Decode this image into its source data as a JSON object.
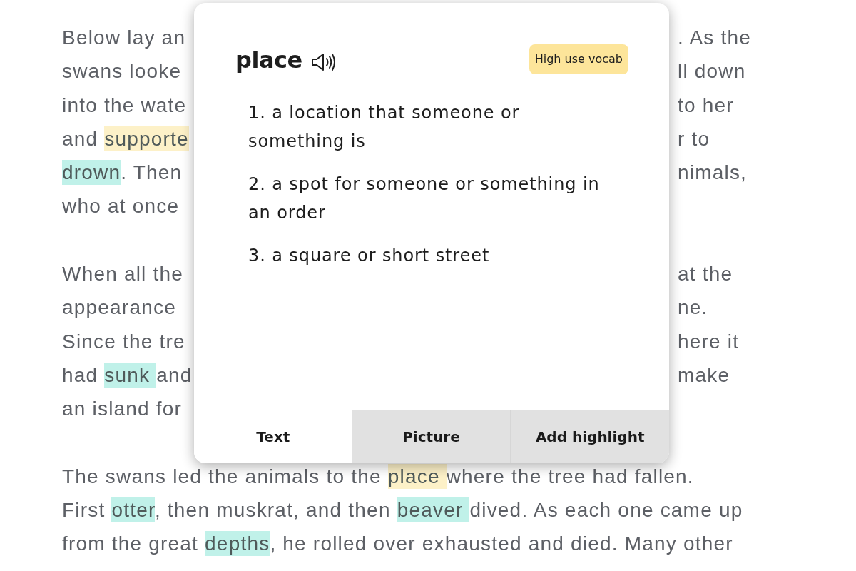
{
  "passage": {
    "paragraphs": [
      {
        "lines": [
          {
            "left": [
              {
                "text": "Below lay an"
              }
            ],
            "right": [
              {
                "text": ". As the"
              }
            ]
          },
          {
            "left": [
              {
                "text": "swans looke"
              }
            ],
            "right": [
              {
                "text": "ll down"
              }
            ]
          },
          {
            "left": [
              {
                "text": "into the wate"
              }
            ],
            "right": [
              {
                "text": "to her"
              }
            ]
          },
          {
            "left": [
              {
                "text": "and "
              },
              {
                "text": "supporte",
                "color": "#fdf1c8"
              }
            ],
            "right": [
              {
                "text": "r to"
              }
            ]
          },
          {
            "left": [
              {
                "text": "drown",
                "color": "#c0f1e9"
              },
              {
                "text": ". Then"
              }
            ],
            "right": [
              {
                "text": "nimals,"
              }
            ]
          },
          {
            "left": [
              {
                "text": "who at once"
              }
            ]
          }
        ]
      },
      {
        "lines": [
          {
            "left": [
              {
                "text": "When all the"
              }
            ],
            "right": [
              {
                "text": "at the"
              }
            ]
          },
          {
            "left": [
              {
                "text": "appearance"
              }
            ],
            "right": [
              {
                "text": "ne."
              }
            ]
          },
          {
            "left": [
              {
                "text": "Since the tre"
              }
            ],
            "right": [
              {
                "text": "here it"
              }
            ]
          },
          {
            "left": [
              {
                "text": "had "
              },
              {
                "text": "sunk ",
                "color": "#c0f1e9"
              },
              {
                "text": "and"
              }
            ],
            "right": [
              {
                "text": "make"
              }
            ]
          },
          {
            "left": [
              {
                "text": "an island for"
              }
            ]
          }
        ]
      },
      {
        "lines": [
          {
            "segments": [
              {
                "text": "The swans led the animals to the "
              },
              {
                "text": "place ",
                "color": "#fdf1c8"
              },
              {
                "text": "where the tree had fallen."
              }
            ]
          },
          {
            "segments": [
              {
                "text": "First "
              },
              {
                "text": "otter",
                "color": "#c0f1e9"
              },
              {
                "text": ", then muskrat, and then "
              },
              {
                "text": "beaver ",
                "color": "#c0f1e9"
              },
              {
                "text": "dived. As each one came up"
              }
            ]
          },
          {
            "segments": [
              {
                "text": "from the great "
              },
              {
                "text": "depths",
                "color": "#c0f1e9"
              },
              {
                "text": ", he rolled over exhausted and died. Many other"
              }
            ]
          }
        ]
      }
    ]
  },
  "popup": {
    "word": "place",
    "badge": "High use vocab",
    "definitions": [
      "1. a location that someone or something is",
      "2. a spot for someone or something in an order",
      "3. a square or short street"
    ],
    "tabs": [
      {
        "label": "Text",
        "selected": true
      },
      {
        "label": "Picture",
        "selected": false
      },
      {
        "label": "Add highlight",
        "selected": false
      }
    ]
  }
}
